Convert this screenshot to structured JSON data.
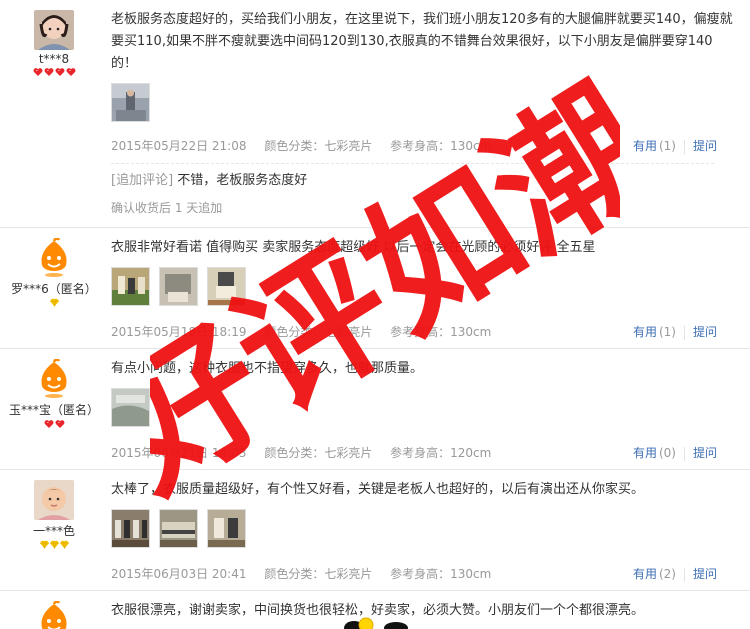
{
  "colors": {
    "accent": "#3c6eb4",
    "watermark": "#ee1111",
    "meta": "#999999"
  },
  "watermark": {
    "text": "好评如潮"
  },
  "reviews": [
    {
      "user": {
        "name": "t***8",
        "avatar": "child-photo-avatar",
        "rank_icon": "heart-icon",
        "rank_count": 4
      },
      "text": "老板服务态度超好的，买给我们小朋友，在这里说下，我们班小朋友120多有的大腿偏胖就要买140，偏瘦就要买110,如果不胖不瘦就要选中间码120到130,衣服真的不错舞台效果很好，以下小朋友是偏胖要穿140的！",
      "photos": 1,
      "date": "2015年05月22日 21:08",
      "color": "颜色分类：七彩亮片",
      "height": "参考身高：130cm",
      "useful_label": "有用",
      "useful_count": "(1)",
      "ask_label": "提问",
      "append": {
        "tag": "[追加评论]",
        "text": "不错，老板服务态度好",
        "time": "确认收货后 1 天追加"
      }
    },
    {
      "user": {
        "name": "罗***6（匿名）",
        "avatar": "orange-mascot-avatar",
        "rank_icon": "diamond-icon",
        "rank_count": 1
      },
      "text": "衣服非常好看诺 值得购买 卖家服务态度超级好 以后一定会在光顾的必须好评 全五星",
      "photos": 3,
      "date": "2015年05月18日 18:19",
      "color": "颜色分类：七彩亮片",
      "height": "参考身高：130cm",
      "useful_label": "有用",
      "useful_count": "(1)",
      "ask_label": "提问"
    },
    {
      "user": {
        "name": "玉***宝（匿名）",
        "avatar": "orange-mascot-avatar",
        "rank_icon": "heart-icon",
        "rank_count": 2
      },
      "text": "有点小问题，这种衣服也不指望穿多久，也就那质量。",
      "photos": 1,
      "date": "2015年06月21日 14:03",
      "color": "颜色分类：七彩亮片",
      "height": "参考身高：120cm",
      "useful_label": "有用",
      "useful_count": "(0)",
      "ask_label": "提问"
    },
    {
      "user": {
        "name": "一***色",
        "avatar": "baby-photo-avatar",
        "rank_icon": "diamond-icon",
        "rank_count": 3
      },
      "text": "太棒了，衣服质量超级好，有个性又好看，关键是老板人也超好的，以后有演出还从你家买。",
      "photos": 3,
      "date": "2015年06月03日 20:41",
      "color": "颜色分类：七彩亮片",
      "height": "参考身高：130cm",
      "useful_label": "有用",
      "useful_count": "(2)",
      "ask_label": "提问"
    },
    {
      "user": {
        "avatar": "orange-mascot-avatar"
      },
      "text": "衣服很漂亮，谢谢卖家，中间换货也很轻松，好卖家，必须大赞。小朋友们一个个都很漂亮。"
    }
  ]
}
